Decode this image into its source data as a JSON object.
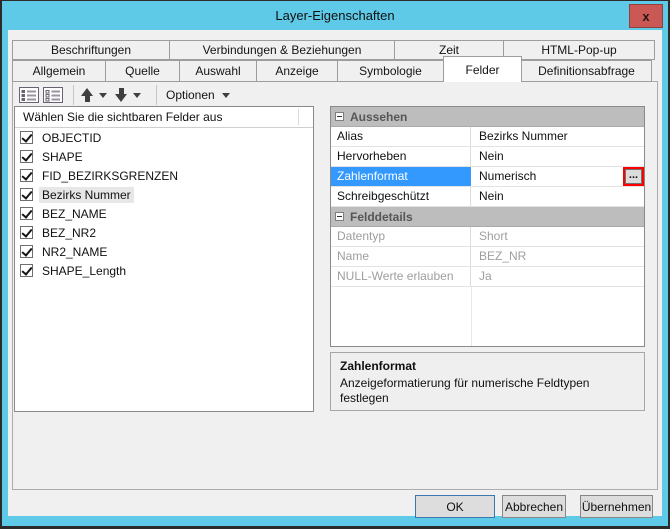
{
  "window": {
    "title": "Layer-Eigenschaften",
    "close_label": "x"
  },
  "colors": {
    "titlebar_blue": "#5FC9E8",
    "close_button_red": "#CA5955",
    "selection_blue": "#3399FF",
    "annotation_red": "#FF0000",
    "dialog_gray": "#F0F0F0",
    "section_header_gray": "#BDBDBD"
  },
  "tabs": {
    "row1": [
      {
        "label": "Beschriftungen"
      },
      {
        "label": "Verbindungen & Beziehungen"
      },
      {
        "label": "Zeit"
      },
      {
        "label": "HTML-Pop-up"
      }
    ],
    "row2": [
      {
        "label": "Allgemein"
      },
      {
        "label": "Quelle"
      },
      {
        "label": "Auswahl"
      },
      {
        "label": "Anzeige"
      },
      {
        "label": "Symbologie"
      },
      {
        "label": "Felder",
        "active": true
      },
      {
        "label": "Definitionsabfrage"
      }
    ]
  },
  "toolbar": {
    "options_label": "Optionen",
    "icons": [
      {
        "name": "check-all-fields-icon"
      },
      {
        "name": "uncheck-all-fields-icon"
      },
      {
        "name": "move-field-up-icon"
      },
      {
        "name": "move-field-down-icon"
      }
    ]
  },
  "field_list": {
    "header": "Wählen Sie die sichtbaren Felder aus",
    "items": [
      {
        "label": "OBJECTID",
        "checked": true
      },
      {
        "label": "SHAPE",
        "checked": true
      },
      {
        "label": "FID_BEZIRKSGRENZEN",
        "checked": true
      },
      {
        "label": "Bezirks Nummer",
        "checked": true,
        "selected": true
      },
      {
        "label": "BEZ_NAME",
        "checked": true
      },
      {
        "label": "BEZ_NR2",
        "checked": true
      },
      {
        "label": "NR2_NAME",
        "checked": true
      },
      {
        "label": "SHAPE_Length",
        "checked": true
      }
    ]
  },
  "property_grid": {
    "ellipsis_label": "...",
    "sections": [
      {
        "title": "Aussehen",
        "rows": [
          {
            "label": "Alias",
            "value": "Bezirks Nummer"
          },
          {
            "label": "Hervorheben",
            "value": "Nein"
          },
          {
            "label": "Zahlenformat",
            "value": "Numerisch",
            "selected": true,
            "has_button": true
          },
          {
            "label": "Schreibgeschützt",
            "value": "Nein"
          }
        ]
      },
      {
        "title": "Felddetails",
        "disabled": true,
        "rows": [
          {
            "label": "Datentyp",
            "value": "Short"
          },
          {
            "label": "Name",
            "value": "BEZ_NR"
          },
          {
            "label": "NULL-Werte erlauben",
            "value": "Ja"
          }
        ]
      }
    ]
  },
  "description": {
    "title": "Zahlenformat",
    "body": "Anzeigeformatierung für numerische Feldtypen festlegen"
  },
  "buttons": {
    "ok": "OK",
    "cancel": "Abbrechen",
    "apply": "Übernehmen"
  }
}
